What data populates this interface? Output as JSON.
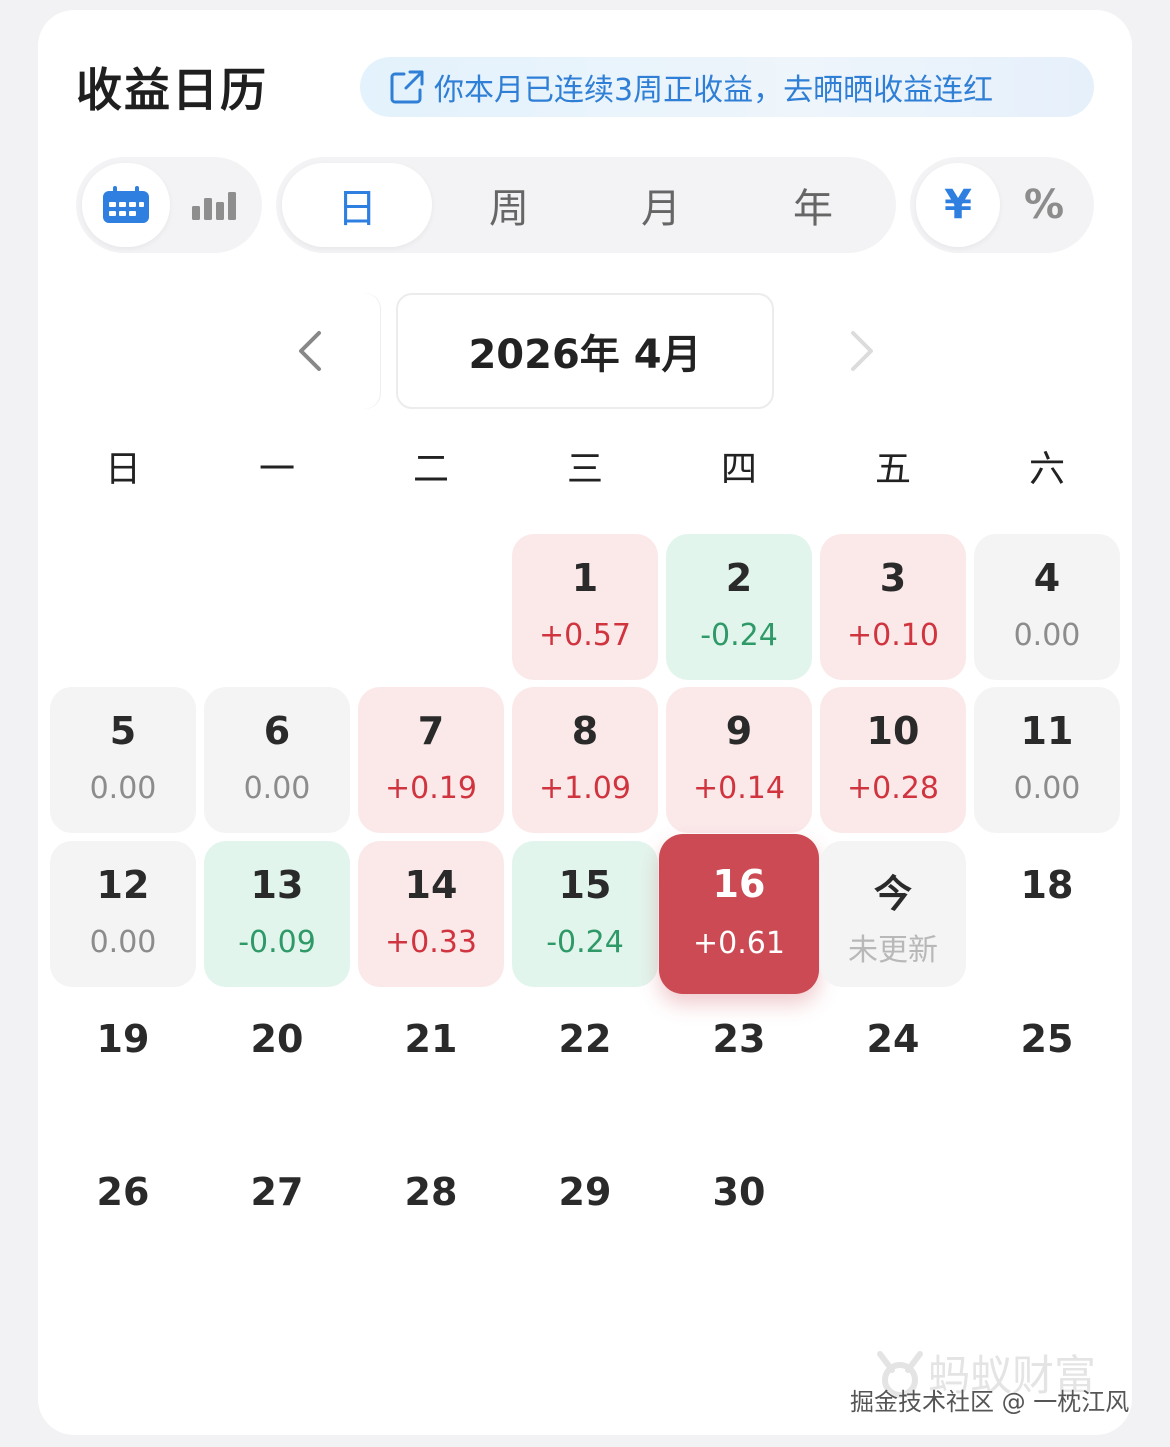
{
  "header": {
    "title": "收益日历",
    "banner_text": "你本月已连续3周正收益，去晒晒收益连红"
  },
  "view_toggle": {
    "calendar_icon": "calendar-icon",
    "chart_icon": "bar-chart-icon",
    "selected": "calendar"
  },
  "period_tabs": {
    "items": [
      "日",
      "周",
      "月",
      "年"
    ],
    "selected": "日"
  },
  "unit_toggle": {
    "items": [
      "¥",
      "%"
    ],
    "selected": "¥"
  },
  "month_nav": {
    "label": "2026年 4月",
    "prev_icon": "chevron-left-icon",
    "next_icon": "chevron-right-icon"
  },
  "weekdays": [
    "日",
    "一",
    "二",
    "三",
    "四",
    "五",
    "六"
  ],
  "colors": {
    "accent": "#2f7fe0",
    "gain": "#d0343e",
    "loss": "#2f9a68",
    "selected_bg": "#cc4a53"
  },
  "days": [
    {
      "day": "1",
      "value": "+0.57",
      "status": "gain"
    },
    {
      "day": "2",
      "value": "-0.24",
      "status": "loss"
    },
    {
      "day": "3",
      "value": "+0.10",
      "status": "gain"
    },
    {
      "day": "4",
      "value": "0.00",
      "status": "flat"
    },
    {
      "day": "5",
      "value": "0.00",
      "status": "flat"
    },
    {
      "day": "6",
      "value": "0.00",
      "status": "flat"
    },
    {
      "day": "7",
      "value": "+0.19",
      "status": "gain"
    },
    {
      "day": "8",
      "value": "+1.09",
      "status": "gain"
    },
    {
      "day": "9",
      "value": "+0.14",
      "status": "gain"
    },
    {
      "day": "10",
      "value": "+0.28",
      "status": "gain"
    },
    {
      "day": "11",
      "value": "0.00",
      "status": "flat"
    },
    {
      "day": "12",
      "value": "0.00",
      "status": "flat"
    },
    {
      "day": "13",
      "value": "-0.09",
      "status": "loss"
    },
    {
      "day": "14",
      "value": "+0.33",
      "status": "gain"
    },
    {
      "day": "15",
      "value": "-0.24",
      "status": "loss"
    },
    {
      "day": "16",
      "value": "+0.61",
      "status": "selected"
    },
    {
      "day": "今",
      "value": "未更新",
      "status": "today"
    },
    {
      "day": "18",
      "value": "",
      "status": "future"
    },
    {
      "day": "19",
      "value": "",
      "status": "future"
    },
    {
      "day": "20",
      "value": "",
      "status": "future"
    },
    {
      "day": "21",
      "value": "",
      "status": "future"
    },
    {
      "day": "22",
      "value": "",
      "status": "future"
    },
    {
      "day": "23",
      "value": "",
      "status": "future"
    },
    {
      "day": "24",
      "value": "",
      "status": "future"
    },
    {
      "day": "25",
      "value": "",
      "status": "future"
    },
    {
      "day": "26",
      "value": "",
      "status": "future"
    },
    {
      "day": "27",
      "value": "",
      "status": "future"
    },
    {
      "day": "28",
      "value": "",
      "status": "future"
    },
    {
      "day": "29",
      "value": "",
      "status": "future"
    },
    {
      "day": "30",
      "value": "",
      "status": "future"
    }
  ],
  "watermark": {
    "brand": "蚂蚁财富",
    "credit": "掘金技术社区 @ 一枕江风"
  }
}
